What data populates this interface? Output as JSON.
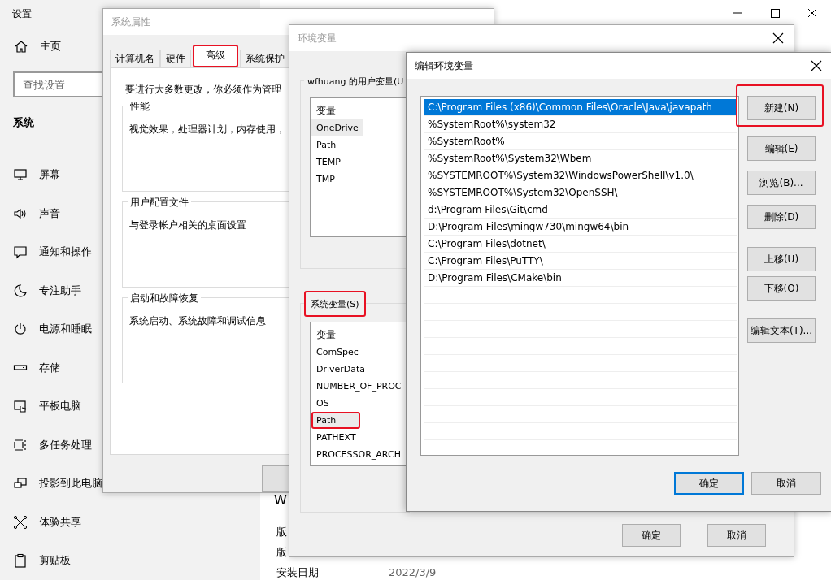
{
  "settings": {
    "title": "设置",
    "home": "主页",
    "search": {
      "placeholder": "查找设置"
    },
    "section": "系统",
    "nav": [
      {
        "label": "屏幕"
      },
      {
        "label": "声音"
      },
      {
        "label": "通知和操作"
      },
      {
        "label": "专注助手"
      },
      {
        "label": "电源和睡眠"
      },
      {
        "label": "存储"
      },
      {
        "label": "平板电脑"
      },
      {
        "label": "多任务处理"
      },
      {
        "label": "投影到此电脑"
      },
      {
        "label": "体验共享"
      },
      {
        "label": "剪贴板"
      }
    ],
    "content": {
      "heading": "W",
      "rows": [
        {
          "label": "版"
        },
        {
          "label": "版"
        },
        {
          "label": "安装日期",
          "value": "2022/3/9"
        }
      ]
    }
  },
  "system_properties": {
    "title": "系统属性",
    "tabs": [
      {
        "label": "计算机名",
        "selected": false,
        "highlighted": false
      },
      {
        "label": "硬件",
        "selected": false,
        "highlighted": false
      },
      {
        "label": "高级",
        "selected": true,
        "highlighted": true
      },
      {
        "label": "系统保护",
        "selected": false,
        "highlighted": false
      }
    ],
    "notice": "要进行大多数更改，你必须作为管理",
    "groups": [
      {
        "title": "性能",
        "text": "视觉效果，处理器计划，内存使用，"
      },
      {
        "title": "用户配置文件",
        "text": "与登录帐户相关的桌面设置"
      },
      {
        "title": "启动和故障恢复",
        "text": "系统启动、系统故障和调试信息"
      }
    ]
  },
  "environment_variables": {
    "title": "环境变量",
    "user_group": {
      "title": "wfhuang 的用户变量(U",
      "highlighted": false,
      "header": "变量",
      "rows": [
        {
          "name": "OneDrive",
          "selected": true,
          "highlighted": false
        },
        {
          "name": "Path",
          "selected": false,
          "highlighted": false
        },
        {
          "name": "TEMP",
          "selected": false,
          "highlighted": false
        },
        {
          "name": "TMP",
          "selected": false,
          "highlighted": false
        }
      ]
    },
    "system_group": {
      "title": "系统变量(S)",
      "highlighted": true,
      "header": "变量",
      "rows": [
        {
          "name": "ComSpec",
          "selected": false,
          "highlighted": false
        },
        {
          "name": "DriverData",
          "selected": false,
          "highlighted": false
        },
        {
          "name": "NUMBER_OF_PROC",
          "selected": false,
          "highlighted": false
        },
        {
          "name": "OS",
          "selected": false,
          "highlighted": false
        },
        {
          "name": "Path",
          "selected": true,
          "highlighted": true
        },
        {
          "name": "PATHEXT",
          "selected": false,
          "highlighted": false
        },
        {
          "name": "PROCESSOR_ARCH",
          "selected": false,
          "highlighted": false
        }
      ]
    },
    "buttons": [
      {
        "label": "确定"
      },
      {
        "label": "取消"
      }
    ]
  },
  "edit_variable": {
    "title": "编辑环境变量",
    "entries": [
      {
        "text": "C:\\Program Files (x86)\\Common Files\\Oracle\\Java\\javapath",
        "selected": true
      },
      {
        "text": "%SystemRoot%\\system32",
        "selected": false
      },
      {
        "text": "%SystemRoot%",
        "selected": false
      },
      {
        "text": "%SystemRoot%\\System32\\Wbem",
        "selected": false
      },
      {
        "text": "%SYSTEMROOT%\\System32\\WindowsPowerShell\\v1.0\\",
        "selected": false
      },
      {
        "text": "%SYSTEMROOT%\\System32\\OpenSSH\\",
        "selected": false
      },
      {
        "text": "d:\\Program Files\\Git\\cmd",
        "selected": false
      },
      {
        "text": "D:\\Program Files\\mingw730\\mingw64\\bin",
        "selected": false
      },
      {
        "text": "C:\\Program Files\\dotnet\\",
        "selected": false
      },
      {
        "text": "C:\\Program Files\\PuTTY\\",
        "selected": false
      },
      {
        "text": "D:\\Program Files\\CMake\\bin",
        "selected": false
      }
    ],
    "action_groups": [
      [
        {
          "label": "新建(N)",
          "highlighted": true
        },
        {
          "label": "编辑(E)",
          "highlighted": false
        },
        {
          "label": "浏览(B)...",
          "highlighted": false
        },
        {
          "label": "删除(D)",
          "highlighted": false
        }
      ],
      [
        {
          "label": "上移(U)",
          "highlighted": false
        },
        {
          "label": "下移(O)",
          "highlighted": false
        }
      ],
      [
        {
          "label": "编辑文本(T)...",
          "highlighted": false
        }
      ]
    ],
    "buttons": [
      {
        "label": "确定",
        "default": true
      },
      {
        "label": "取消",
        "default": false
      }
    ]
  }
}
